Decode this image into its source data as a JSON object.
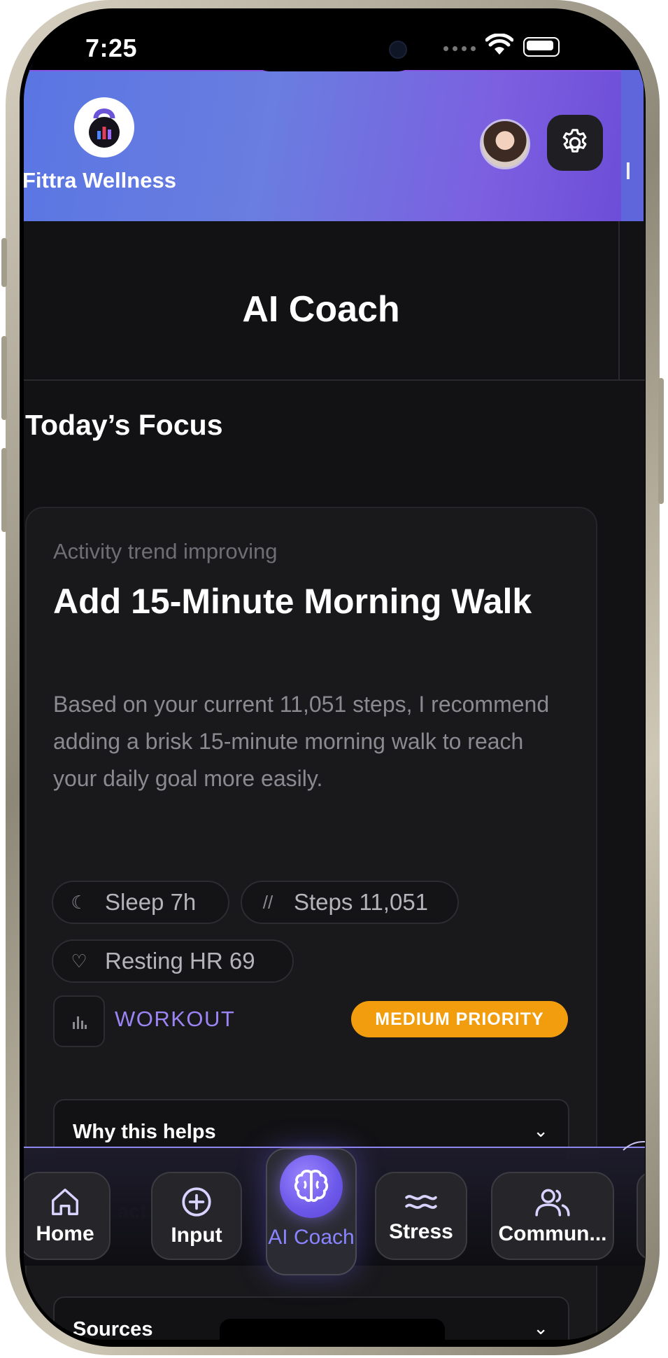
{
  "status_bar": {
    "time": "7:25"
  },
  "header": {
    "brand": "Fittra Wellness"
  },
  "page": {
    "title": "AI Coach",
    "section_heading": "Today’s Focus"
  },
  "focus_card": {
    "eyebrow": "Activity trend improving",
    "title": "Add 15-Minute Morning Walk",
    "description": "Based on your current 11,051 steps, I recommend adding a brisk 15-minute morning walk to reach your daily goal more easily.",
    "metrics": [
      {
        "icon": "moon-icon",
        "label": "Sleep 7h"
      },
      {
        "icon": "steps-icon",
        "label": "Steps 11,051"
      },
      {
        "icon": "heart-icon",
        "label": "Resting HR 69"
      }
    ],
    "type_label": "WORKOUT",
    "priority": "MEDIUM PRIORITY",
    "why_label": "Why this helps",
    "impact_label": "act",
    "sources_label": "Sources"
  },
  "nav": {
    "items": [
      {
        "label": "Home",
        "icon": "home-icon"
      },
      {
        "label": "Input",
        "icon": "plus-circle-icon"
      },
      {
        "label": "AI Coach",
        "icon": "brain-icon"
      },
      {
        "label": "Stress",
        "icon": "waves-icon"
      },
      {
        "label": "Commun...",
        "icon": "users-icon"
      }
    ]
  },
  "colors": {
    "header_start": "#5a76e3",
    "header_end": "#7c5fe0",
    "accent_purple": "#9d84f5",
    "priority_orange": "#f19d0e",
    "background": "#121214"
  }
}
